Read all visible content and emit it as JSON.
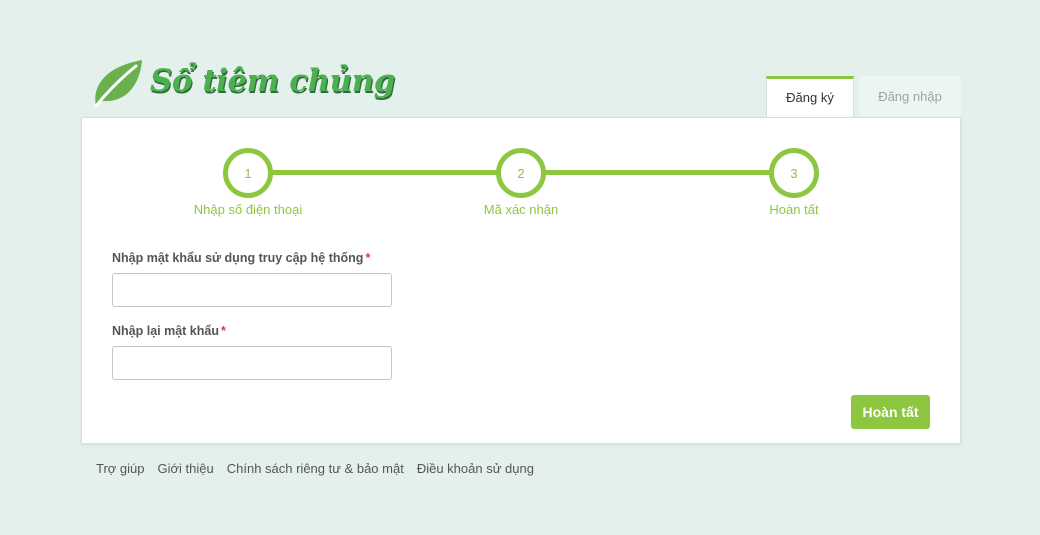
{
  "brand": {
    "name": "Sổ tiêm chủng",
    "logo_icon": "leaf-icon",
    "primary_color": "#8dc63f",
    "logo_color": "#4caf50"
  },
  "tabs": [
    {
      "label": "Đăng ký",
      "active": true
    },
    {
      "label": "Đăng nhập",
      "active": false
    }
  ],
  "steps": [
    {
      "number": "1",
      "label": "Nhập số điện thoại"
    },
    {
      "number": "2",
      "label": "Mã xác nhận"
    },
    {
      "number": "3",
      "label": "Hoàn tất"
    }
  ],
  "form": {
    "password_label": "Nhập mật khẩu sử dụng truy cập hệ thống",
    "password_value": "",
    "confirm_label": "Nhập lại mật khẩu",
    "confirm_value": "",
    "required_mark": "*",
    "required_color": "#e53935",
    "submit_label": "Hoàn tất"
  },
  "footer": {
    "links": [
      "Trợ giúp",
      "Giới thiệu",
      "Chính sách riêng tư & bảo mật",
      "Điều khoản sử dụng"
    ]
  }
}
